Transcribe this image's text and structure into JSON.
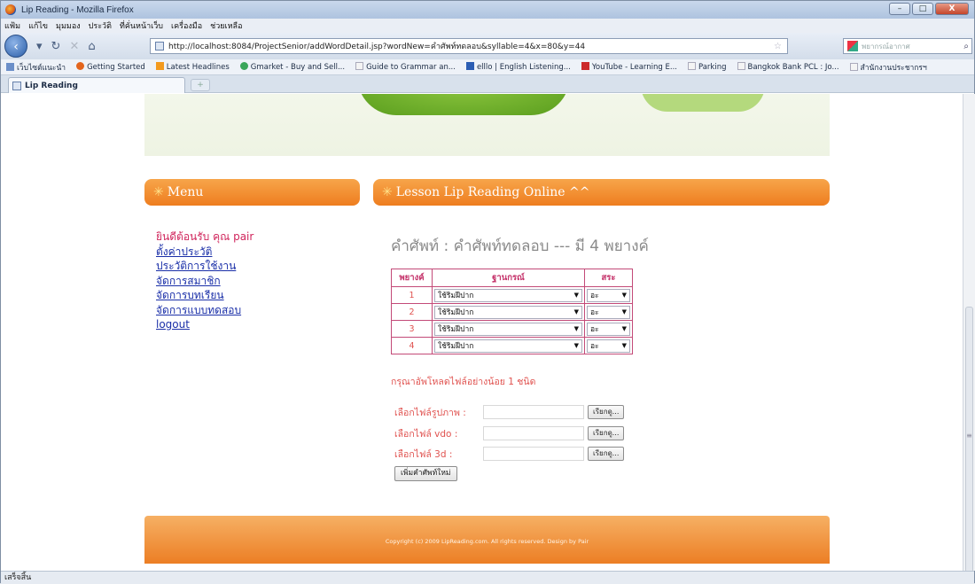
{
  "window": {
    "title": "Lip Reading - Mozilla Firefox",
    "min_label": "–",
    "max_label": "□",
    "close_label": "X"
  },
  "menubar": [
    "แฟ้ม",
    "แก้ไข",
    "มุมมอง",
    "ประวัติ",
    "ที่คั่นหน้าเว็บ",
    "เครื่องมือ",
    "ช่วยเหลือ"
  ],
  "nav": {
    "url": "http://localhost:8084/ProjectSenior/addWordDetail.jsp?wordNew=คำศัพท์ทดลอบ&syllable=4&x=80&y=44",
    "search_placeholder": "พยากรณ์อากาศ"
  },
  "bookmarks": [
    "เว็บไซต์แนะนำ",
    "Getting Started",
    "Latest Headlines",
    "Gmarket - Buy and Sell...",
    "Guide to Grammar an...",
    "elllo | English Listening...",
    "YouTube - Learning E...",
    "Parking",
    "Bangkok Bank PCL : Jo...",
    "สำนักงานประชากรฯ"
  ],
  "tab": {
    "label": "Lip Reading",
    "new_tab": "+"
  },
  "page": {
    "menu_header": "Menu",
    "lesson_header": "Lesson Lip Reading Online ^^",
    "welcome": "ยินดีต้อนรับ คุณ pair",
    "side_links": [
      "ตั้งค่าประวัติ",
      "ประวัติการใช้งาน",
      "จัดการสมาชิก",
      "จัดการบทเรียน",
      "จัดการแบบทดสอบ",
      "logout"
    ],
    "word_title": "คำศัพท์ : คำศัพท์ทดลอบ --- มี 4 พยางค์",
    "table": {
      "headers": [
        "พยางค์",
        "ฐานกรณ์",
        "สระ"
      ],
      "rows": [
        {
          "num": "1",
          "place": "ใช้ริมฝีปาก",
          "vowel": "อะ"
        },
        {
          "num": "2",
          "place": "ใช้ริมฝีปาก",
          "vowel": "อะ"
        },
        {
          "num": "3",
          "place": "ใช้ริมฝีปาก",
          "vowel": "อะ"
        },
        {
          "num": "4",
          "place": "ใช้ริมฝีปาก",
          "vowel": "อะ"
        }
      ]
    },
    "warning": "กรุณาอัพโหลดไฟล์อย่างน้อย 1 ชนิด",
    "file_fields": [
      {
        "label": "เลือกไฟล์รูปภาพ :",
        "button": "เรียกดู..."
      },
      {
        "label": "เลือกไฟล์ vdo :",
        "button": "เรียกดู..."
      },
      {
        "label": "เลือกไฟล์ 3d :",
        "button": "เรียกดู..."
      }
    ],
    "add_button": "เพิ่มคำศัพท์ใหม่",
    "footer": "Copyright (c) 2009 LipReading.com. All rights reserved. Design by Pair"
  },
  "status": "เสร็จสิ้น"
}
